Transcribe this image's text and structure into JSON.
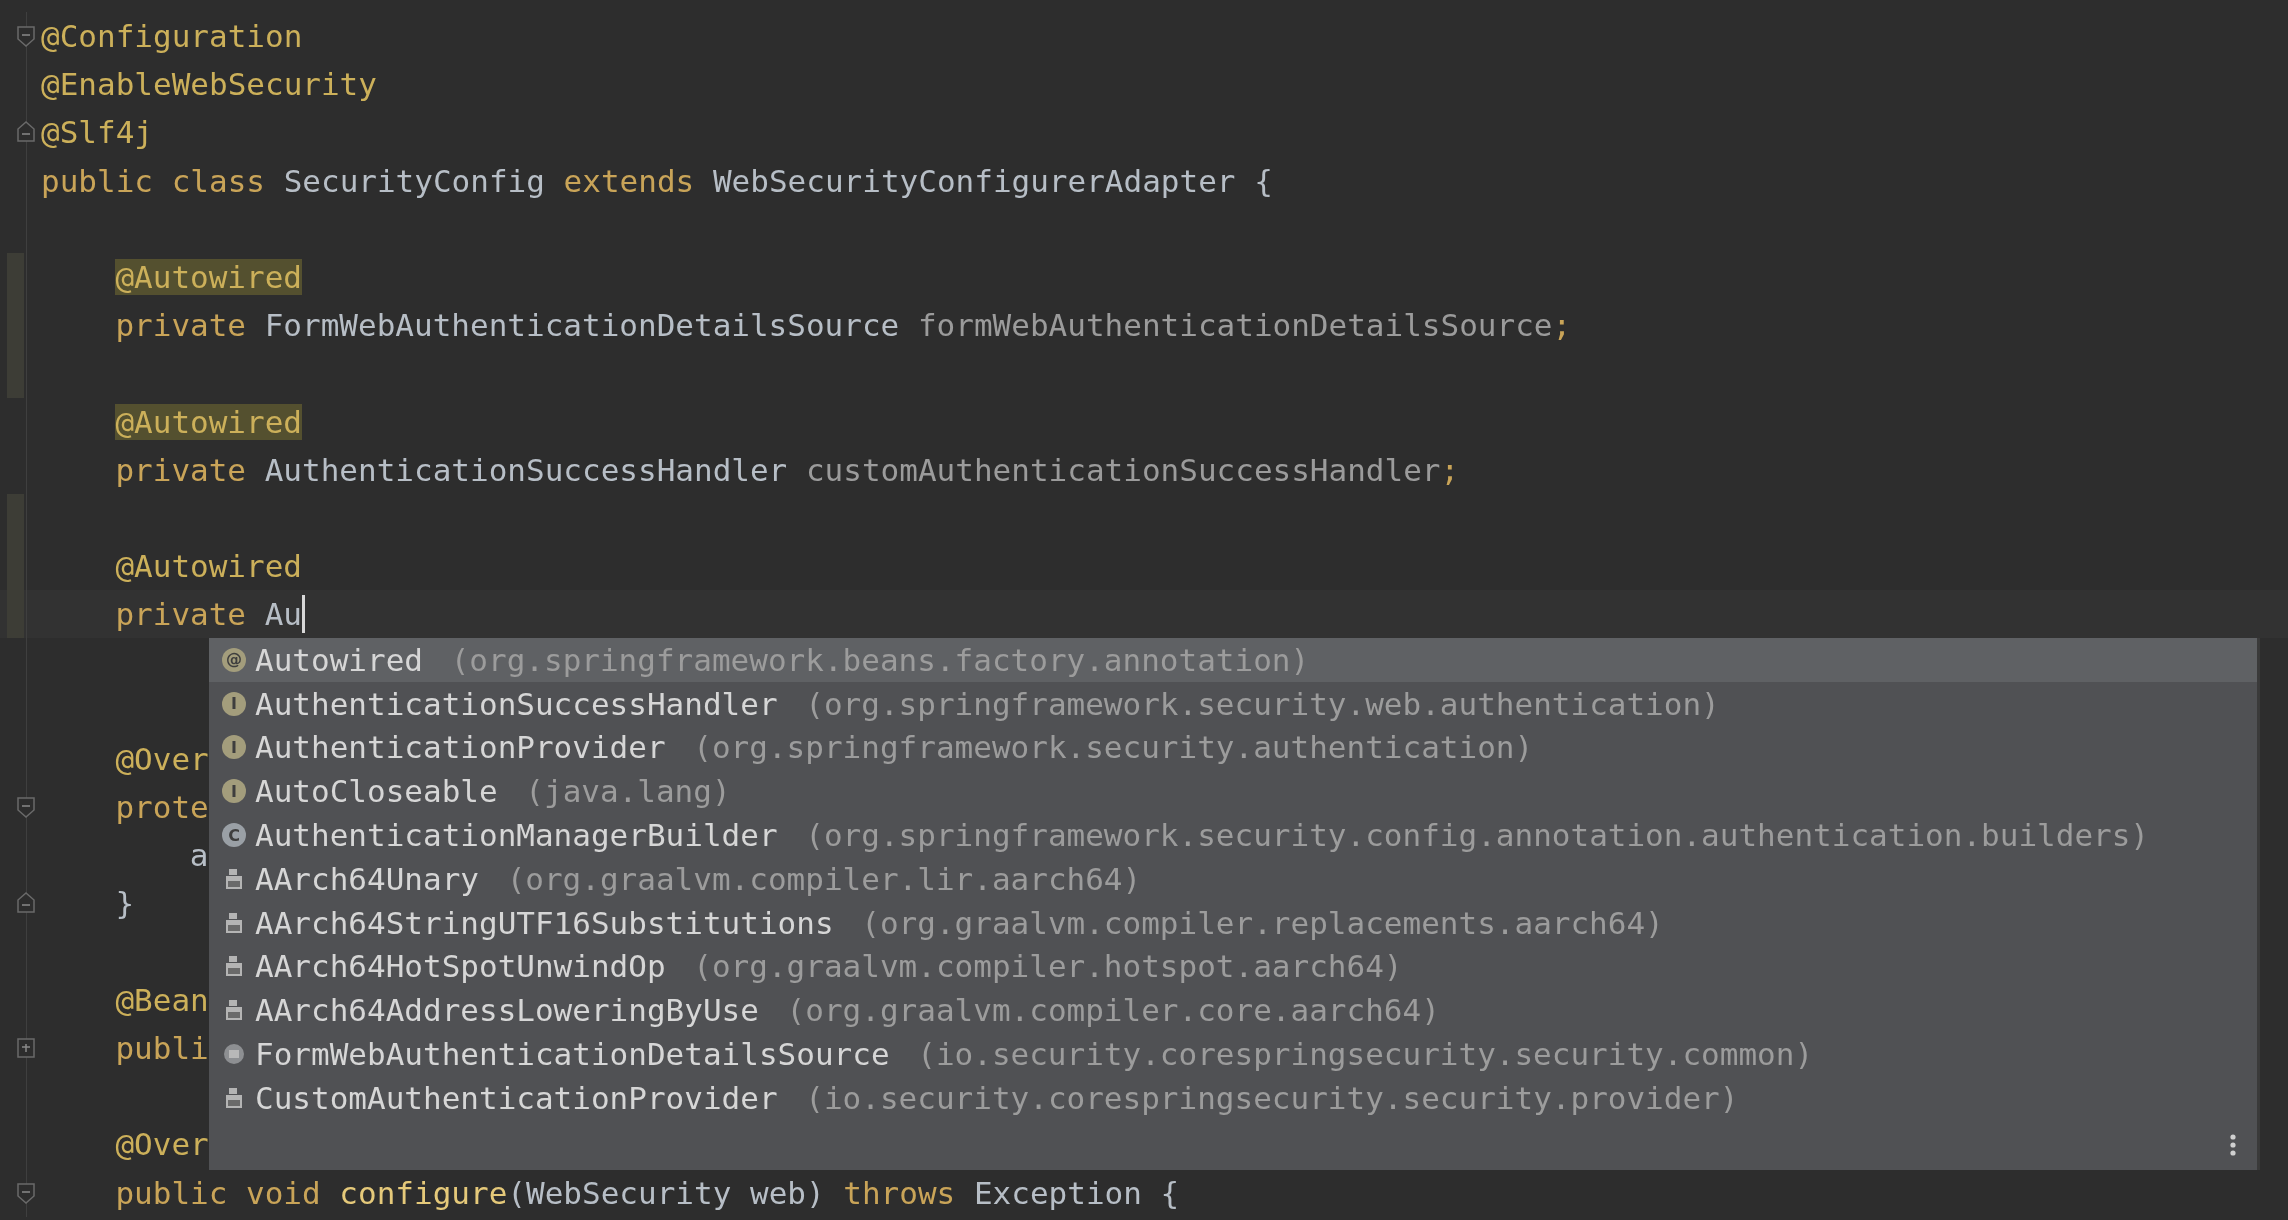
{
  "editor": {
    "lines": [
      {
        "kind": "top",
        "gutter": {
          "kind": "fold_start"
        },
        "tokens": [
          {
            "kind": "annotation",
            "text": "@Configuration"
          }
        ]
      },
      {
        "kind": "top",
        "tokens": [
          {
            "kind": "annotation",
            "text": "@EnableWebSecurity"
          }
        ]
      },
      {
        "kind": "top",
        "gutter": {
          "kind": "fold_end"
        },
        "tokens": [
          {
            "kind": "annotation",
            "text": "@Slf4j"
          }
        ]
      },
      {
        "kind": "top",
        "tokens": [
          {
            "kind": "keyword",
            "text": "public class "
          },
          {
            "kind": "type",
            "text": "SecurityConfig "
          },
          {
            "kind": "keyword",
            "text": "extends "
          },
          {
            "kind": "type",
            "text": "WebSecurityConfigurerAdapter {"
          }
        ]
      },
      {
        "kind": "blank"
      },
      {
        "kind": "member",
        "changed": true,
        "tokens": [
          {
            "kind": "annotation_match",
            "text": "@Autowired"
          }
        ]
      },
      {
        "kind": "member",
        "changed": true,
        "tokens": [
          {
            "kind": "keyword",
            "text": "private "
          },
          {
            "kind": "type",
            "text": "FormWebAuthenticationDetailsSource "
          },
          {
            "kind": "field",
            "text": "formWebAuthenticationDetailsSource"
          },
          {
            "kind": "keyword",
            "text": ";"
          }
        ]
      },
      {
        "kind": "blank",
        "changed": true
      },
      {
        "kind": "member",
        "tokens": [
          {
            "kind": "annotation_match",
            "text": "@Autowired"
          }
        ]
      },
      {
        "kind": "member",
        "tokens": [
          {
            "kind": "keyword",
            "text": "private "
          },
          {
            "kind": "type",
            "text": "AuthenticationSuccessHandler "
          },
          {
            "kind": "field",
            "text": "customAuthenticationSuccessHandler"
          },
          {
            "kind": "keyword",
            "text": ";"
          }
        ]
      },
      {
        "kind": "blank",
        "changed": true
      },
      {
        "kind": "member",
        "changed": true,
        "tokens": [
          {
            "kind": "annotation",
            "text": "@Autowired"
          }
        ]
      },
      {
        "kind": "member",
        "changed": true,
        "current": true,
        "caret": true,
        "tokens": [
          {
            "kind": "keyword",
            "text": "private "
          },
          {
            "kind": "type",
            "text": "Au"
          }
        ]
      },
      {
        "kind": "blank"
      },
      {
        "kind": "blank"
      },
      {
        "kind": "member",
        "tokens": [
          {
            "kind": "annotation",
            "text": "@Over"
          }
        ]
      },
      {
        "kind": "member",
        "gutter": {
          "kind": "fold_start"
        },
        "tokens": [
          {
            "kind": "keyword",
            "text": "prote"
          }
        ]
      },
      {
        "kind": "body",
        "tokens": [
          {
            "kind": "type",
            "text": "a"
          }
        ]
      },
      {
        "kind": "member",
        "gutter": {
          "kind": "fold_end"
        },
        "tokens": [
          {
            "kind": "type",
            "text": "}"
          }
        ]
      },
      {
        "kind": "blank"
      },
      {
        "kind": "member",
        "tokens": [
          {
            "kind": "annotation",
            "text": "@Bean"
          }
        ]
      },
      {
        "kind": "member",
        "gutter": {
          "kind": "fold_collapsed"
        },
        "tokens": [
          {
            "kind": "keyword",
            "text": "publi"
          }
        ]
      },
      {
        "kind": "blank"
      },
      {
        "kind": "member",
        "tokens": [
          {
            "kind": "annotation",
            "text": "@Over"
          }
        ]
      },
      {
        "kind": "member",
        "gutter": {
          "kind": "fold_start"
        },
        "tokens": [
          {
            "kind": "keyword",
            "text": "public void "
          },
          {
            "kind": "method",
            "text": "configure"
          },
          {
            "kind": "type",
            "text": "(WebSecurity web) "
          },
          {
            "kind": "keyword",
            "text": "throws "
          },
          {
            "kind": "type",
            "text": "Exception {"
          }
        ]
      }
    ]
  },
  "completion": {
    "items": [
      {
        "kind": "annotation",
        "glyph": "@",
        "name": "Autowired",
        "package": "(org.springframework.beans.factory.annotation)",
        "selected": true
      },
      {
        "kind": "interface",
        "glyph": "I",
        "name": "AuthenticationSuccessHandler",
        "package": "(org.springframework.security.web.authentication)",
        "selected": false
      },
      {
        "kind": "interface",
        "glyph": "I",
        "name": "AuthenticationProvider",
        "package": "(org.springframework.security.authentication)",
        "selected": false
      },
      {
        "kind": "interface",
        "glyph": "I",
        "name": "AutoCloseable",
        "package": "(java.lang)",
        "selected": false
      },
      {
        "kind": "class",
        "glyph": "C",
        "name": "AuthenticationManagerBuilder",
        "package": "(org.springframework.security.config.annotation.authentication.builders)",
        "selected": false
      },
      {
        "kind": "binary",
        "name": "AArch64Unary",
        "package": "(org.graalvm.compiler.lir.aarch64)",
        "selected": false
      },
      {
        "kind": "binary",
        "name": "AArch64StringUTF16Substitutions",
        "package": "(org.graalvm.compiler.replacements.aarch64)",
        "selected": false
      },
      {
        "kind": "binary",
        "name": "AArch64HotSpotUnwindOp",
        "package": "(org.graalvm.compiler.hotspot.aarch64)",
        "selected": false
      },
      {
        "kind": "binary",
        "name": "AArch64AddressLoweringByUse",
        "package": "(org.graalvm.compiler.core.aarch64)",
        "selected": false
      },
      {
        "kind": "module",
        "name": "FormWebAuthenticationDetailsSource",
        "package": "(io.security.corespringsecurity.security.common)",
        "selected": false
      },
      {
        "kind": "binary",
        "name": "CustomAuthenticationProvider",
        "package": "(io.security.corespringsecurity.security.provider)",
        "selected": false
      }
    ]
  }
}
